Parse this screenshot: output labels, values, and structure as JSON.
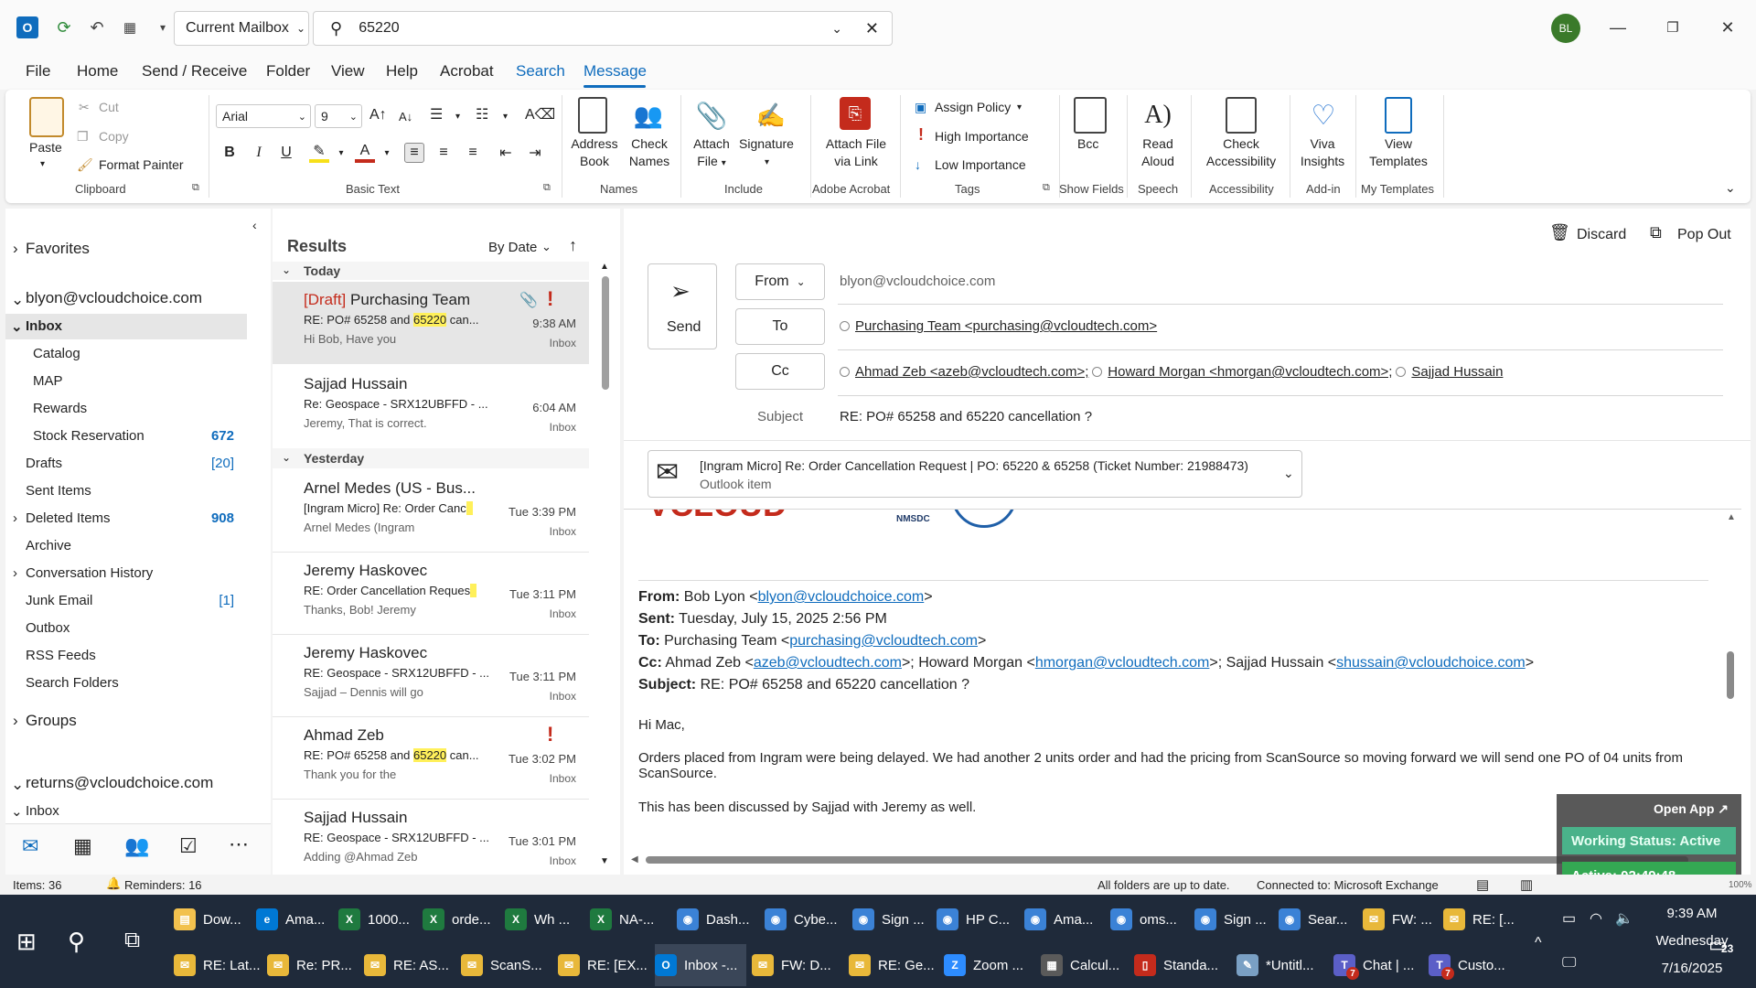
{
  "titlebar": {
    "mailbox": "Current Mailbox",
    "search_value": "65220",
    "avatar_initials": "BL"
  },
  "menu": [
    "File",
    "Home",
    "Send / Receive",
    "Folder",
    "View",
    "Help",
    "Acrobat",
    "Search",
    "Message"
  ],
  "ribbon": {
    "clipboard": {
      "paste": "Paste",
      "cut": "Cut",
      "copy": "Copy",
      "format_painter": "Format Painter",
      "label": "Clipboard"
    },
    "basic_text": {
      "font": "Arial",
      "size": "9",
      "label": "Basic Text"
    },
    "names": {
      "address_book": [
        "Address",
        "Book"
      ],
      "check_names": [
        "Check",
        "Names"
      ],
      "label": "Names"
    },
    "include": {
      "attach_file": [
        "Attach",
        "File"
      ],
      "signature": "Signature",
      "label": "Include"
    },
    "adobe": {
      "attach_link": [
        "Attach File",
        "via Link"
      ],
      "label": "Adobe Acrobat"
    },
    "tags": {
      "assign_policy": "Assign Policy",
      "high": "High Importance",
      "low": "Low Importance",
      "label": "Tags"
    },
    "show_fields": {
      "bcc": "Bcc",
      "label": "Show Fields"
    },
    "speech": {
      "read_aloud": [
        "Read",
        "Aloud"
      ],
      "label": "Speech"
    },
    "accessibility": {
      "check": [
        "Check",
        "Accessibility"
      ],
      "label": "Accessibility"
    },
    "addin": {
      "viva": [
        "Viva",
        "Insights"
      ],
      "label": "Add-in"
    },
    "templates": {
      "view": [
        "View",
        "Templates"
      ],
      "label": "My Templates"
    }
  },
  "nav": {
    "favorites": "Favorites",
    "account1": "blyon@vcloudchoice.com",
    "inbox": "Inbox",
    "catalog": "Catalog",
    "map": "MAP",
    "rewards": "Rewards",
    "stock": "Stock Reservation",
    "stock_count": "672",
    "drafts": "Drafts",
    "drafts_count": "[20]",
    "sent": "Sent Items",
    "deleted": "Deleted Items",
    "deleted_count": "908",
    "archive": "Archive",
    "conv_history": "Conversation History",
    "junk": "Junk Email",
    "junk_count": "[1]",
    "outbox": "Outbox",
    "rss": "RSS Feeds",
    "search_folders": "Search Folders",
    "groups": "Groups",
    "account2": "returns@vcloudchoice.com",
    "inbox2": "Inbox"
  },
  "list": {
    "title": "Results",
    "sort": "By Date",
    "group_today": "Today",
    "group_yesterday": "Yesterday",
    "m1": {
      "draft": "[Draft]",
      "sender": " Purchasing Team",
      "subj_a": "RE: PO# 65258 and ",
      "subj_hl": "65220",
      "subj_b": " can...",
      "prev": "Hi Bob,  Have you",
      "time": "9:38 AM",
      "folder": "Inbox"
    },
    "m2": {
      "sender": "Sajjad Hussain",
      "subj": "Re: Geospace - SRX12UBFFD - ...",
      "prev": "Jeremy, That is correct.",
      "time": "6:04 AM",
      "folder": "Inbox"
    },
    "m3": {
      "sender": "Arnel Medes (US - Bus...",
      "subj": "[Ingram Micro] Re: Order Canc",
      "prev": "Arnel Medes (Ingram",
      "time": "Tue 3:39 PM",
      "folder": "Inbox"
    },
    "m4": {
      "sender": "Jeremy Haskovec",
      "subj": "RE: Order Cancellation Reques",
      "prev": "Thanks, Bob!  Jeremy",
      "time": "Tue 3:11 PM",
      "folder": "Inbox"
    },
    "m5": {
      "sender": "Jeremy Haskovec",
      "subj": "RE: Geospace - SRX12UBFFD - ...",
      "prev": "Sajjad – Dennis will go",
      "time": "Tue 3:11 PM",
      "folder": "Inbox"
    },
    "m6": {
      "sender": "Ahmad Zeb",
      "subj_a": "RE: PO# 65258 and ",
      "subj_hl": "65220",
      "subj_b": " can...",
      "prev": "Thank you for the",
      "time": "Tue 3:02 PM",
      "folder": "Inbox"
    },
    "m7": {
      "sender": "Sajjad Hussain",
      "subj": "RE: Geospace - SRX12UBFFD - ...",
      "prev": "Adding @Ahmad Zeb",
      "time": "Tue 3:01 PM",
      "folder": "Inbox"
    }
  },
  "compose": {
    "discard": "Discard",
    "popout": "Pop Out",
    "send": "Send",
    "from_btn": "From",
    "from_value": "blyon@vcloudchoice.com",
    "to_btn": "To",
    "to_value": "Purchasing Team <purchasing@vcloudtech.com>",
    "cc_btn": "Cc",
    "cc1": "Ahmad Zeb <azeb@vcloudtech.com>;",
    "cc2": "Howard Morgan <hmorgan@vcloudtech.com>;",
    "cc3": "Sajjad Hussain",
    "subject_lbl": "Subject",
    "subject_value": "RE: PO# 65258 and 65220 cancellation ?",
    "attach_title": "[Ingram Micro] Re: Order Cancellation Request | PO: 65220 & 65258 (Ticket Number: 21988473)",
    "attach_type": "Outlook item",
    "logo_nmsdc": "NMSDC",
    "body": {
      "from_lbl": "From:",
      "from_name": " Bob Lyon <",
      "from_email": "blyon@vcloudchoice.com",
      "sent_lbl": "Sent:",
      "sent_val": " Tuesday, July 15, 2025 2:56 PM",
      "to_lbl": "To:",
      "to_name": " Purchasing Team <",
      "to_email": "purchasing@vcloudtech.com",
      "cc_lbl": "Cc:",
      "cc_a": " Ahmad Zeb <",
      "cc_a_email": "azeb@vcloudtech.com",
      "cc_b": ">; Howard Morgan <",
      "cc_b_email": "hmorgan@vcloudtech.com",
      "cc_c": ">; Sajjad Hussain <",
      "cc_c_email": "shussain@vcloudchoice.com",
      "subj_lbl": "Subject:",
      "subj_val": " RE: PO# 65258 and 65220 cancellation ?",
      "greeting": "Hi Mac,",
      "para1": "Orders placed from Ingram were being delayed. We had another 2 units order and had the pricing from ScanSource so moving forward we will send one PO of 04 units from ScanSource.",
      "para2": "This has been discussed by Sajjad with Jeremy as well."
    }
  },
  "widget": {
    "open_app": "Open App ↗",
    "status": "Working Status: Active",
    "timer": "Active: 02:49:48"
  },
  "statusbar": {
    "items": "Items: 36",
    "reminders": "Reminders: 16",
    "uptodate": "All folders are up to date.",
    "connected": "Connected to: Microsoft Exchange",
    "zoom": "100%"
  },
  "taskbar": {
    "row1": [
      "Dow...",
      "Ama...",
      "1000...",
      "orde...",
      "Wh ...",
      "NA-...",
      "Dash...",
      "Cybe...",
      "Sign ...",
      "HP C...",
      "Ama...",
      "oms...",
      "Sign ...",
      "Sear...",
      "FW: ...",
      "RE: [..."
    ],
    "row2": [
      "RE: Lat...",
      "Re: PR...",
      "RE: AS...",
      "ScanS...",
      "RE: [EX...",
      "Inbox -...",
      "FW: D...",
      "RE: Ge...",
      "Zoom ...",
      "Calcul...",
      "Standa...",
      "*Untitl...",
      "Chat | ...",
      "Custo..."
    ],
    "badge": "7",
    "time": "9:39 AM",
    "day": "Wednesday",
    "date": "7/16/2025",
    "notif": "23"
  },
  "colors": {
    "accent": "#0f6cbd",
    "draft_red": "#c42b1c",
    "highlight": "#fff05a"
  }
}
